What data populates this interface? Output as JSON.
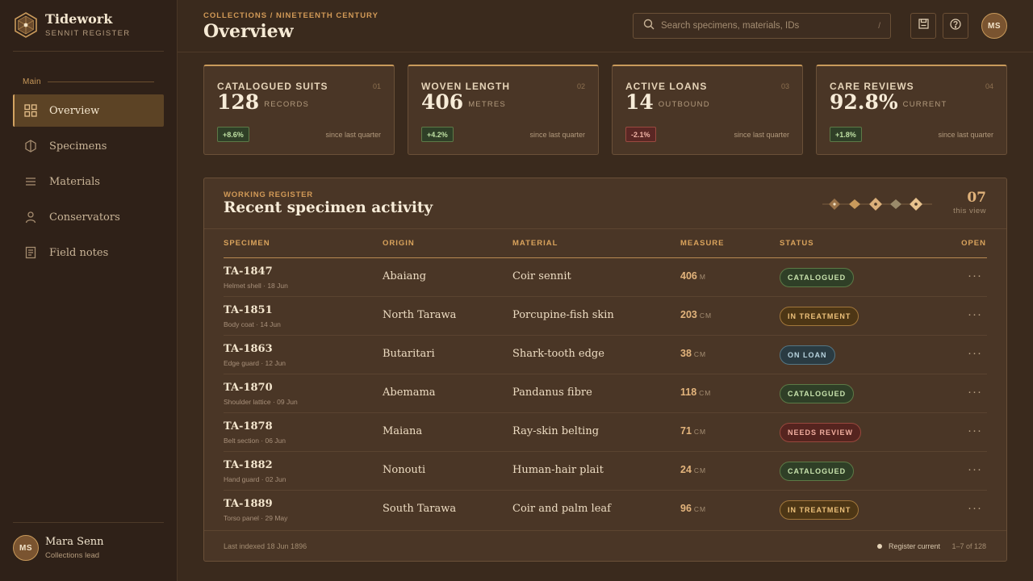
{
  "brand": {
    "name": "Tidework",
    "subtitle": "SENNIT REGISTER"
  },
  "nav": {
    "section": "Main",
    "items": [
      {
        "label": "Overview",
        "icon": "grid-icon",
        "active": true
      },
      {
        "label": "Specimens",
        "icon": "hexagon-icon"
      },
      {
        "label": "Materials",
        "icon": "list-icon"
      },
      {
        "label": "Conservators",
        "icon": "person-icon"
      },
      {
        "label": "Field notes",
        "icon": "notes-icon"
      }
    ]
  },
  "user": {
    "initials": "MS",
    "name": "Mara Senn",
    "role": "Collections lead"
  },
  "header": {
    "breadcrumb": "COLLECTIONS / NINETEENTH CENTURY",
    "title": "Overview",
    "search_placeholder": "Search specimens, materials, IDs",
    "search_shortcut": "/",
    "avatar_initials": "MS"
  },
  "stats": [
    {
      "label": "CATALOGUED SUITS",
      "index": "01",
      "value": "128",
      "unit": "RECORDS",
      "delta": "+8.6%",
      "trend": "up",
      "note": "since last quarter"
    },
    {
      "label": "WOVEN LENGTH",
      "index": "02",
      "value": "406",
      "unit": "METRES",
      "delta": "+4.2%",
      "trend": "up",
      "note": "since last quarter"
    },
    {
      "label": "ACTIVE LOANS",
      "index": "03",
      "value": "14",
      "unit": "OUTBOUND",
      "delta": "-2.1%",
      "trend": "down",
      "note": "since last quarter"
    },
    {
      "label": "CARE REVIEWS",
      "index": "04",
      "value": "92.8%",
      "unit": "CURRENT",
      "delta": "+1.8%",
      "trend": "up",
      "note": "since last quarter"
    }
  ],
  "panel": {
    "kicker": "WORKING REGISTER",
    "title": "Recent specimen activity",
    "count": "07",
    "count_label": "this view",
    "columns": [
      "SPECIMEN",
      "ORIGIN",
      "MATERIAL",
      "MEASURE",
      "STATUS",
      "OPEN"
    ],
    "rows": [
      {
        "id": "TA-1847",
        "sub": "Helmet shell · 18 Jun",
        "origin": "Abaiang",
        "material": "Coir sennit",
        "measure": "406",
        "unit": "M",
        "status": "CATALOGUED",
        "status_kind": "cat"
      },
      {
        "id": "TA-1851",
        "sub": "Body coat · 14 Jun",
        "origin": "North Tarawa",
        "material": "Porcupine-fish skin",
        "measure": "203",
        "unit": "CM",
        "status": "IN TREATMENT",
        "status_kind": "tre"
      },
      {
        "id": "TA-1863",
        "sub": "Edge guard · 12 Jun",
        "origin": "Butaritari",
        "material": "Shark-tooth edge",
        "measure": "38",
        "unit": "CM",
        "status": "ON LOAN",
        "status_kind": "loan"
      },
      {
        "id": "TA-1870",
        "sub": "Shoulder lattice · 09 Jun",
        "origin": "Abemama",
        "material": "Pandanus fibre",
        "measure": "118",
        "unit": "CM",
        "status": "CATALOGUED",
        "status_kind": "cat"
      },
      {
        "id": "TA-1878",
        "sub": "Belt section · 06 Jun",
        "origin": "Maiana",
        "material": "Ray-skin belting",
        "measure": "71",
        "unit": "CM",
        "status": "NEEDS REVIEW",
        "status_kind": "rev"
      },
      {
        "id": "TA-1882",
        "sub": "Hand guard · 02 Jun",
        "origin": "Nonouti",
        "material": "Human-hair plait",
        "measure": "24",
        "unit": "CM",
        "status": "CATALOGUED",
        "status_kind": "cat"
      },
      {
        "id": "TA-1889",
        "sub": "Torso panel · 29 May",
        "origin": "South Tarawa",
        "material": "Coir and palm leaf",
        "measure": "96",
        "unit": "CM",
        "status": "IN TREATMENT",
        "status_kind": "tre"
      }
    ],
    "open_label": "···",
    "footer_left": "Last indexed 18 Jun 1896",
    "footer_status": "Register current",
    "footer_page": "1–7 of 128"
  },
  "colors": {
    "accent": "#c99a5b",
    "bg": "#3a2a1d",
    "panel": "#4a3626"
  }
}
